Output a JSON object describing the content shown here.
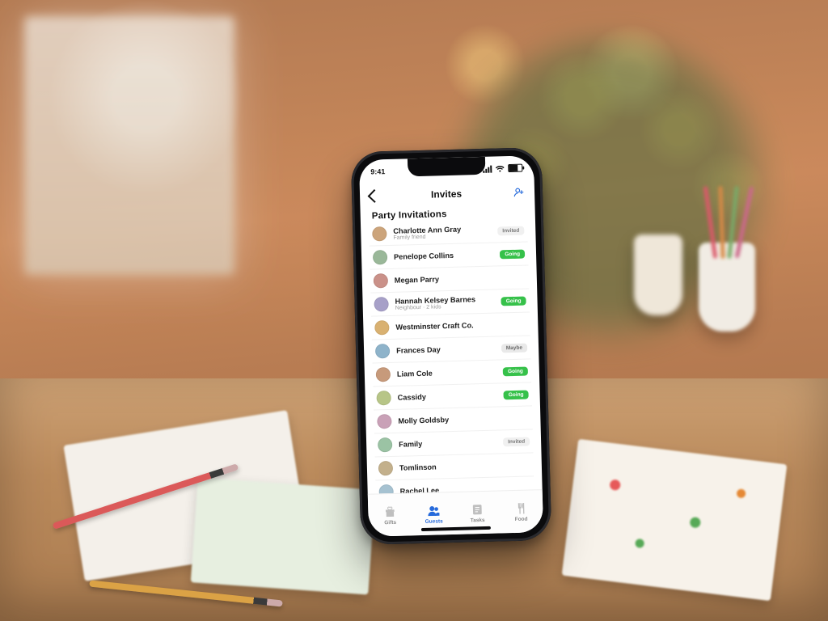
{
  "statusbar": {
    "time": "9:41"
  },
  "navbar": {
    "title": "Invites"
  },
  "section": {
    "heading": "Party Invitations"
  },
  "guests": [
    {
      "name": "Charlotte Ann Gray",
      "sub": "Family friend",
      "status": "invited"
    },
    {
      "name": "Penelope Collins",
      "sub": "",
      "status": "accepted"
    },
    {
      "name": "Megan Parry",
      "sub": "",
      "status": "none"
    },
    {
      "name": "Hannah Kelsey Barnes",
      "sub": "Neighbour · 2 kids",
      "status": "accepted"
    },
    {
      "name": "Westminster Craft Co.",
      "sub": "",
      "status": "none"
    },
    {
      "name": "Frances Day",
      "sub": "",
      "status": "pending"
    },
    {
      "name": "Liam Cole",
      "sub": "",
      "status": "accepted"
    },
    {
      "name": "Cassidy",
      "sub": "",
      "status": "accepted"
    },
    {
      "name": "Molly Goldsby",
      "sub": "",
      "status": "none"
    },
    {
      "name": "Family",
      "sub": "",
      "status": "invited"
    },
    {
      "name": "Tomlinson",
      "sub": "",
      "status": "none"
    },
    {
      "name": "Rachel Lee",
      "sub": "",
      "status": "none"
    }
  ],
  "badges": {
    "accepted": "Going",
    "pending": "Maybe",
    "invited": "Invited"
  },
  "tabs": [
    {
      "label": "Gifts"
    },
    {
      "label": "Guests"
    },
    {
      "label": "Tasks"
    },
    {
      "label": "Food"
    }
  ]
}
